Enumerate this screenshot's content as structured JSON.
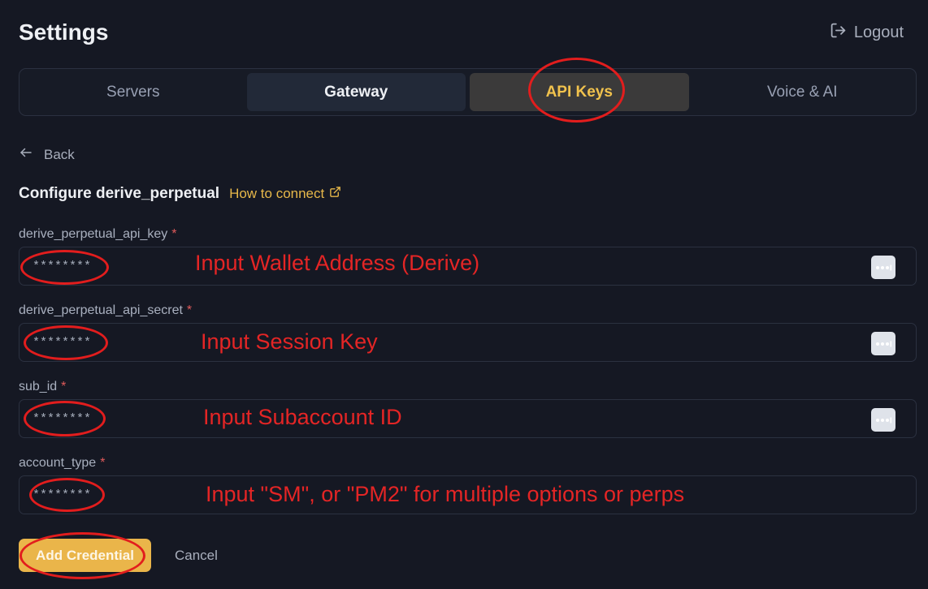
{
  "header": {
    "title": "Settings",
    "logout_label": "Logout"
  },
  "tabs": [
    {
      "label": "Servers",
      "active": false
    },
    {
      "label": "Gateway",
      "active": false
    },
    {
      "label": "API Keys",
      "active": true
    },
    {
      "label": "Voice & AI",
      "active": false
    }
  ],
  "back_label": "Back",
  "config": {
    "title": "Configure derive_perpetual",
    "how_to_connect": "How to connect"
  },
  "required_marker": "*",
  "fields": [
    {
      "label": "derive_perpetual_api_key",
      "placeholder": "********",
      "annotation": "Input Wallet Address (Derive)"
    },
    {
      "label": "derive_perpetual_api_secret",
      "placeholder": "********",
      "annotation": "Input Session Key"
    },
    {
      "label": "sub_id",
      "placeholder": "********",
      "annotation": "Input Subaccount ID"
    },
    {
      "label": "account_type",
      "placeholder": "********",
      "annotation": "Input \"SM\", or \"PM2\" for multiple options or perps"
    }
  ],
  "actions": {
    "add_label": "Add Credential",
    "cancel_label": "Cancel"
  },
  "colors": {
    "background": "#151823",
    "accent": "#eab54a",
    "active_tab_text": "#f1c24d",
    "required": "#e05a5a",
    "annotation": "#e42525"
  },
  "icons": {
    "logout": "logout-icon",
    "back": "arrow-left-icon",
    "external": "external-link-icon",
    "password_manager": "more-dots-icon"
  }
}
